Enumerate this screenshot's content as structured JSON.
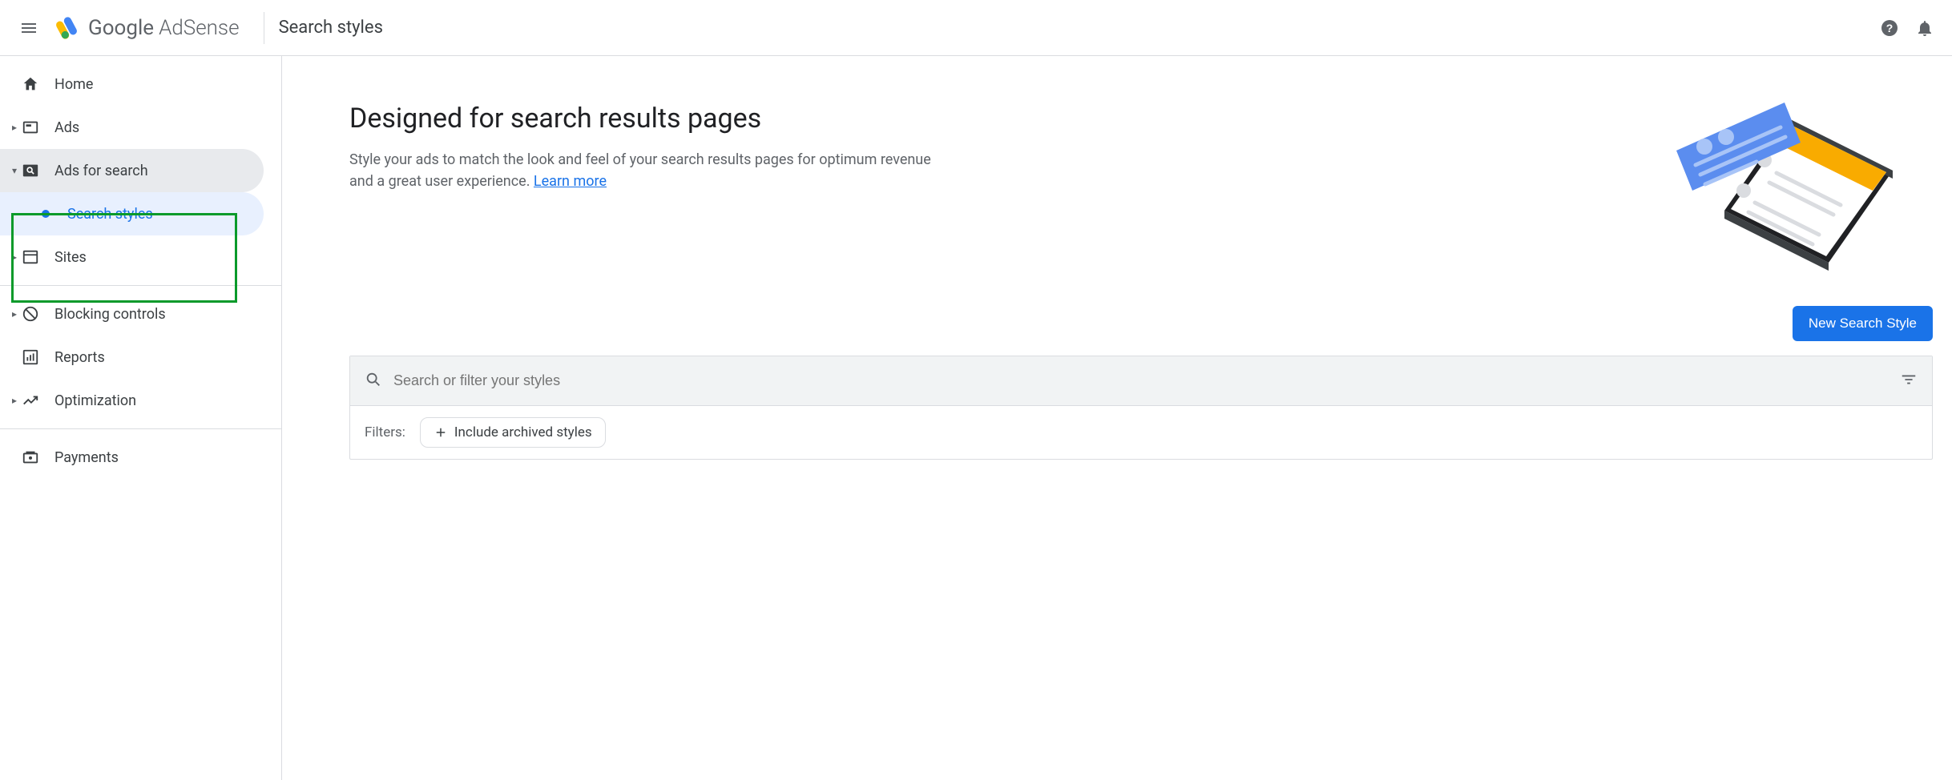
{
  "header": {
    "brand_google": "Google",
    "brand_product": "AdSense",
    "page_title": "Search styles"
  },
  "sidebar": {
    "items": [
      {
        "label": "Home"
      },
      {
        "label": "Ads"
      },
      {
        "label": "Ads for search"
      },
      {
        "label": "Search styles"
      },
      {
        "label": "Sites"
      },
      {
        "label": "Blocking controls"
      },
      {
        "label": "Reports"
      },
      {
        "label": "Optimization"
      },
      {
        "label": "Payments"
      }
    ]
  },
  "main": {
    "hero_title": "Designed for search results pages",
    "hero_body": "Style your ads to match the look and feel of your search results pages for optimum revenue and a great user experience. ",
    "hero_link": "Learn more",
    "new_button": "New Search Style",
    "search_placeholder": "Search or filter your styles",
    "filters_label": "Filters:",
    "chip_archived": "Include archived styles"
  }
}
